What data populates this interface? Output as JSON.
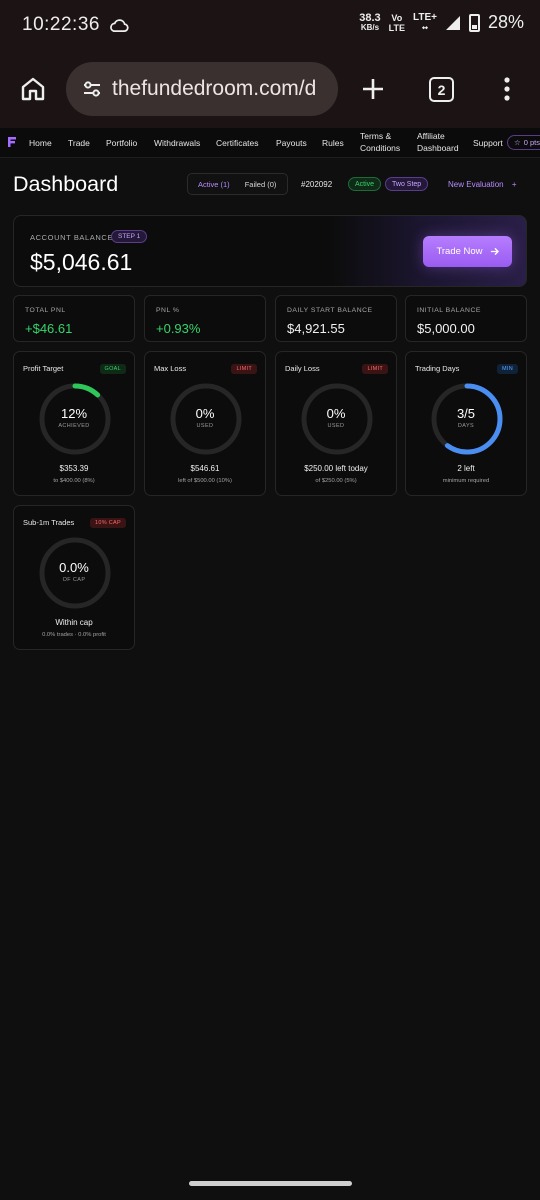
{
  "status_bar": {
    "time": "10:22:36",
    "net_speed": "38.3",
    "net_unit": "KB/s",
    "volte_top": "Vo",
    "volte_bottom": "LTE",
    "lte": "LTE+",
    "battery": "28%"
  },
  "browser": {
    "url": "thefundedroom.com/d",
    "tab_count": "2"
  },
  "nav": {
    "items": [
      "Home",
      "Trade",
      "Portfolio",
      "Withdrawals",
      "Certificates",
      "Payouts",
      "Rules"
    ],
    "terms_line1": "Terms &",
    "terms_line2": "Conditions",
    "affiliate_line1": "Affiliate",
    "affiliate_line2": "Dashboard",
    "support": "Support",
    "points": "0 pts"
  },
  "header": {
    "title": "Dashboard",
    "tab_active": "Active (1)",
    "tab_failed": "Failed (0)",
    "account_id": "#202092",
    "status_badge": "Active",
    "phase_badge": "Two Step",
    "new_evaluation": "New Evaluation"
  },
  "balance": {
    "label": "ACCOUNT BALANCE",
    "step": "STEP 1",
    "value": "$5,046.61",
    "trade_button": "Trade Now"
  },
  "stats": [
    {
      "label": "TOTAL PNL",
      "value": "+$46.61",
      "positive": true
    },
    {
      "label": "PNL %",
      "value": "+0.93%",
      "positive": true
    },
    {
      "label": "DAILY START BALANCE",
      "value": "$4,921.55",
      "positive": false
    },
    {
      "label": "INITIAL BALANCE",
      "value": "$5,000.00",
      "positive": false
    }
  ],
  "gauges": [
    {
      "title": "Profit Target",
      "badge": "GOAL",
      "value": "12%",
      "sub": "ACHIEVED",
      "main": "$353.39",
      "note": "to $400.00 (8%)",
      "progress": 0.12,
      "color": "#2fc75a"
    },
    {
      "title": "Max Loss",
      "badge": "LIMIT",
      "value": "0%",
      "sub": "USED",
      "main": "$546.61",
      "note": "left of $500.00 (10%)",
      "progress": 0,
      "color": "#ff5a5a"
    },
    {
      "title": "Daily Loss",
      "badge": "LIMIT",
      "value": "0%",
      "sub": "USED",
      "main": "$250.00 left today",
      "note": "of $250.00 (5%)",
      "progress": 0,
      "color": "#ff5a5a"
    },
    {
      "title": "Trading Days",
      "badge": "MIN",
      "value": "3/5",
      "sub": "DAYS",
      "main": "2 left",
      "note": "minimum required",
      "progress": 0.6,
      "color": "#4a8ef2"
    },
    {
      "title": "Sub-1m Trades",
      "badge": "10% CAP",
      "value": "0.0%",
      "sub": "OF CAP",
      "main": "Within cap",
      "note": "0.0% trades · 0.0% profit",
      "progress": 0,
      "color": "#ff5a5a"
    }
  ]
}
